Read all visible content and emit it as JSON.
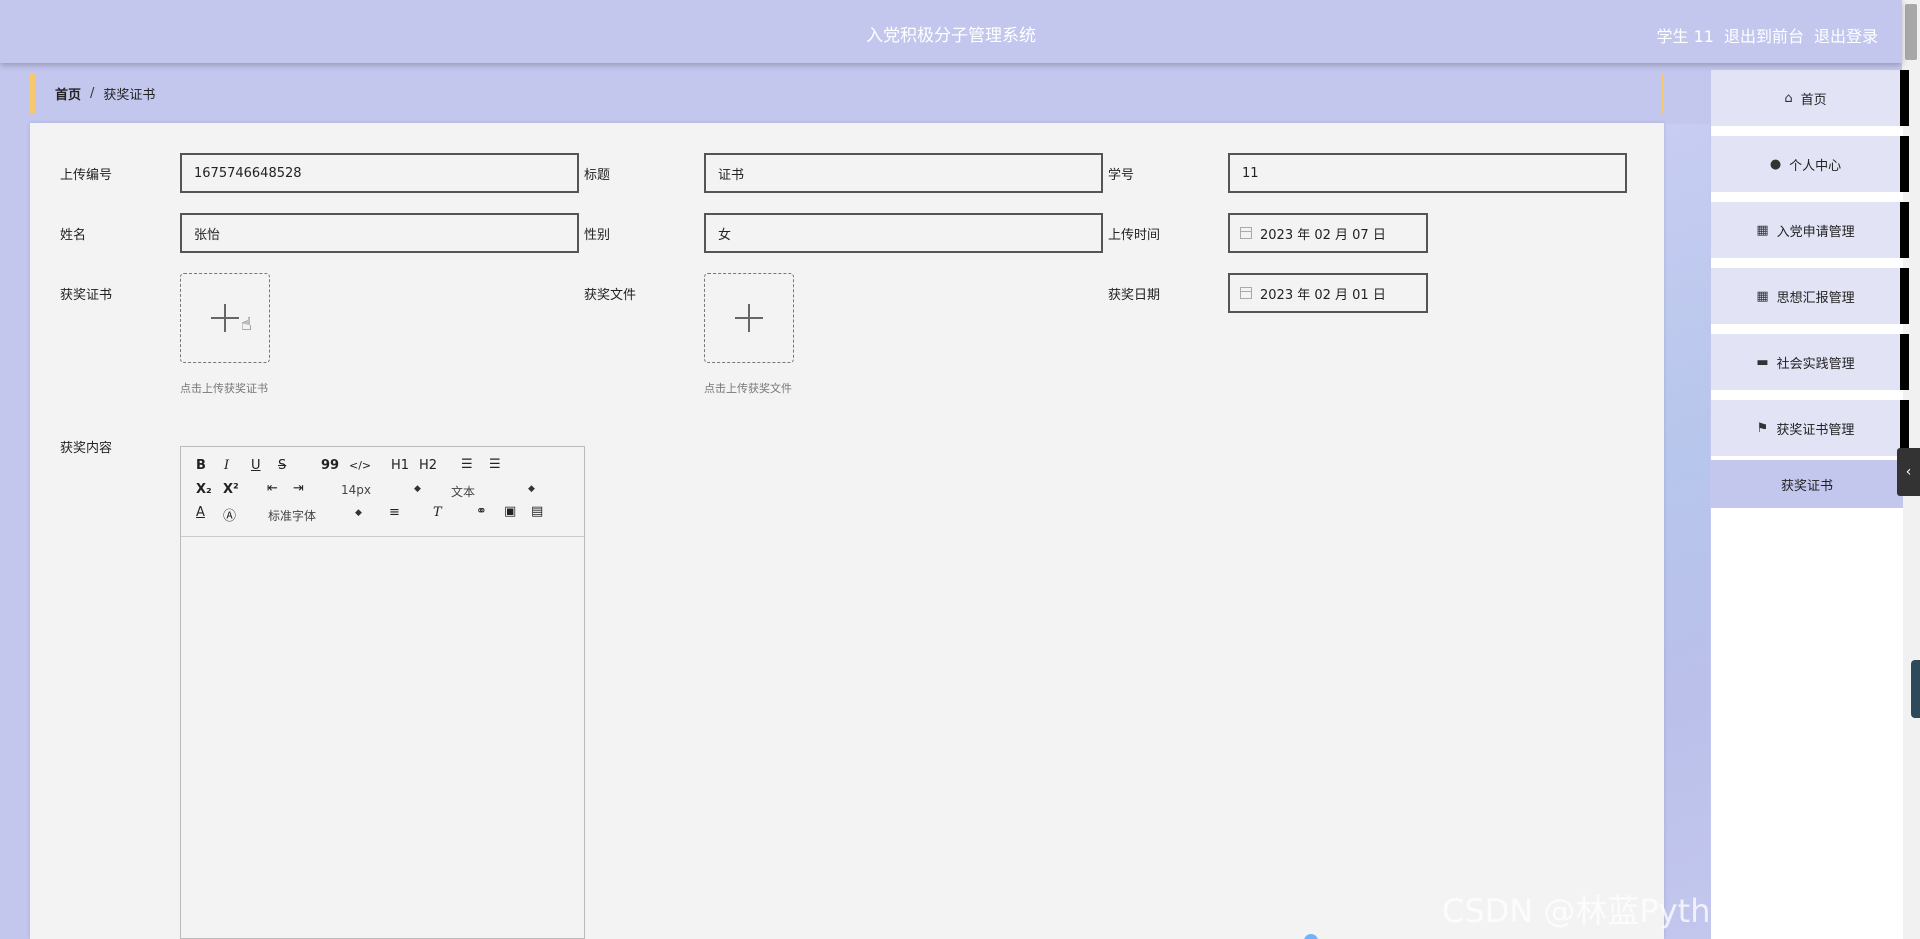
{
  "header": {
    "title": "入党积极分子管理系统",
    "user": "学生 11",
    "to_front": "退出到前台",
    "logout": "退出登录"
  },
  "breadcrumb": {
    "home": "首页",
    "separator": "/",
    "current": "获奖证书"
  },
  "form": {
    "upload_no": {
      "label": "上传编号",
      "value": "1675746648528"
    },
    "title": {
      "label": "标题",
      "value": "证书"
    },
    "student_no": {
      "label": "学号",
      "value": "11"
    },
    "name": {
      "label": "姓名",
      "value": "张怡"
    },
    "gender": {
      "label": "性别",
      "value": "女"
    },
    "upload_time": {
      "label": "上传时间",
      "value": "2023 年 02 月 07 日"
    },
    "certificate": {
      "label": "获奖证书",
      "hint": "点击上传获奖证书"
    },
    "award_file": {
      "label": "获奖文件",
      "hint": "点击上传获奖文件"
    },
    "award_date": {
      "label": "获奖日期",
      "value": "2023 年 02 月 01 日"
    },
    "content": {
      "label": "获奖内容"
    }
  },
  "editor": {
    "bold": "B",
    "italic": "I",
    "underline": "U",
    "strike": "S",
    "quote": "99",
    "code": "</>",
    "h1": "H1",
    "h2": "H2",
    "sub": "X₂",
    "sup": "X²",
    "size": "14px",
    "block": "文本",
    "font": "标准字体"
  },
  "sidebar": {
    "items": [
      {
        "label": "首页",
        "icon": "home-icon",
        "glyph": "⌂"
      },
      {
        "label": "个人中心",
        "icon": "user-icon",
        "glyph": "●"
      },
      {
        "label": "入党申请管理",
        "icon": "grid-icon",
        "glyph": "▦"
      },
      {
        "label": "思想汇报管理",
        "icon": "grid-icon",
        "glyph": "▦"
      },
      {
        "label": "社会实践管理",
        "icon": "briefcase-icon",
        "glyph": "▬"
      },
      {
        "label": "获奖证书管理",
        "icon": "flag-icon",
        "glyph": "⚑"
      }
    ],
    "submenu": "获奖证书",
    "collapse": "‹"
  },
  "watermark": "CSDN @林蓝Python程序源码",
  "colors": {
    "header": "#c3c7ee",
    "accent": "#f7c86e",
    "panel": "#f3f3f3"
  }
}
